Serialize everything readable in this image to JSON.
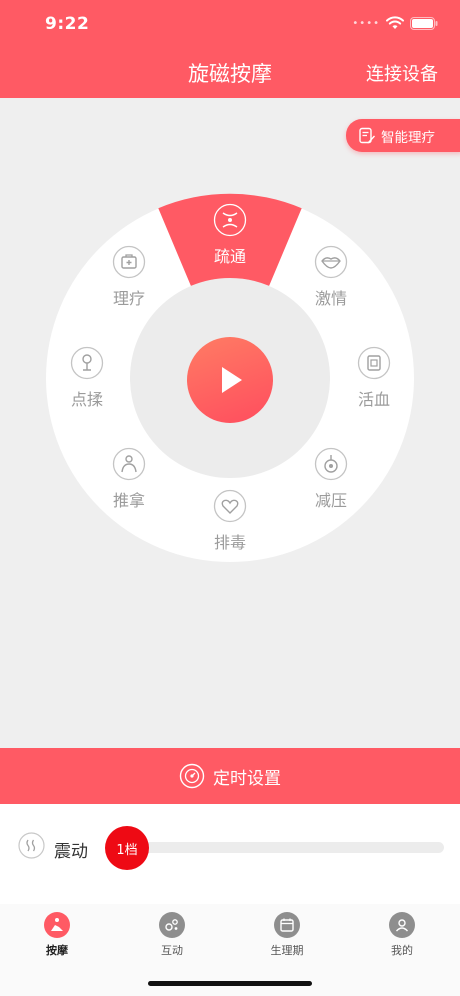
{
  "status": {
    "time": "9:22"
  },
  "header": {
    "title": "旋磁按摩",
    "connect": "连接设备"
  },
  "smart_therapy": {
    "label": "智能理疗"
  },
  "dial": {
    "items": [
      {
        "label": "疏通",
        "icon": "unblock-icon",
        "active": true
      },
      {
        "label": "激情",
        "icon": "lips-icon",
        "active": false
      },
      {
        "label": "活血",
        "icon": "circulation-icon",
        "active": false
      },
      {
        "label": "减压",
        "icon": "relax-icon",
        "active": false
      },
      {
        "label": "排毒",
        "icon": "detox-heart-icon",
        "active": false
      },
      {
        "label": "推拿",
        "icon": "massage-icon",
        "active": false
      },
      {
        "label": "点揉",
        "icon": "knead-icon",
        "active": false
      },
      {
        "label": "理疗",
        "icon": "medkit-icon",
        "active": false
      }
    ]
  },
  "timer": {
    "label": "定时设置"
  },
  "vibration": {
    "label": "震动",
    "level_label": "1档",
    "level": 1
  },
  "tabs": [
    {
      "label": "按摩",
      "icon": "massage-tab-icon",
      "active": true
    },
    {
      "label": "互动",
      "icon": "interact-tab-icon",
      "active": false
    },
    {
      "label": "生理期",
      "icon": "calendar-tab-icon",
      "active": false
    },
    {
      "label": "我的",
      "icon": "profile-tab-icon",
      "active": false
    }
  ],
  "colors": {
    "accent": "#ff5a64",
    "background": "#efefef",
    "knob": "#ee0a14"
  }
}
